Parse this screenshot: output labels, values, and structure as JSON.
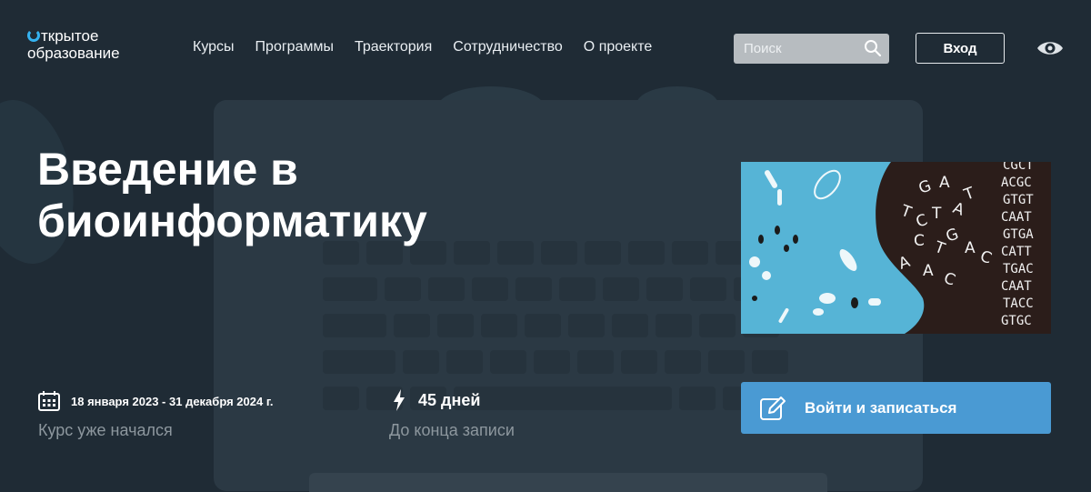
{
  "header": {
    "logo_line1": "ткрытое",
    "logo_line2": "образование",
    "nav": [
      "Курсы",
      "Программы",
      "Траектория",
      "Сотрудничество",
      "О проекте"
    ],
    "search_placeholder": "Поиск",
    "login_label": "Вход"
  },
  "hero": {
    "title_line1": "Введение в",
    "title_line2": "биоинформатику",
    "dna_letters": [
      "CGCT",
      "ACGC",
      "GTGT",
      "CAAT",
      "GTGA",
      "CATT",
      "TGAC",
      "CAAT",
      "TACC",
      "GTGC"
    ],
    "floating_letters": [
      "G",
      "A",
      "T",
      "C",
      "T",
      "A",
      "T",
      "C",
      "T",
      "G",
      "A",
      "C",
      "A",
      "A",
      "C"
    ]
  },
  "course": {
    "dates": "18 января 2023 - 31 декабря 2024 г.",
    "status": "Курс уже начался",
    "days_left": "45 дней",
    "days_caption": "До конца записи",
    "enroll_label": "Войти и записаться"
  },
  "colors": {
    "background": "#1f2b35",
    "accent": "#4a9ad3",
    "logo_ring": "#35b2f0"
  },
  "icons": [
    "search-icon",
    "eye-icon",
    "calendar-icon",
    "lightning-icon",
    "pencil-icon"
  ]
}
